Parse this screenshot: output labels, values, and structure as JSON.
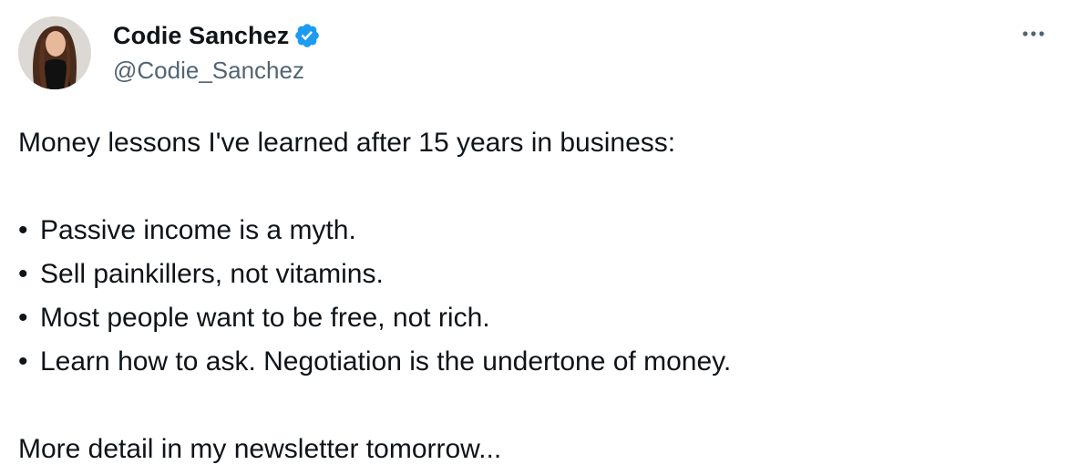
{
  "author": {
    "display_name": "Codie Sanchez",
    "handle": "@Codie_Sanchez",
    "verified": true
  },
  "tweet": {
    "intro": "Money lessons I've learned after 15 years in business:",
    "bullet_char": "•",
    "bullets": [
      "Passive income is a myth.",
      "Sell painkillers, not vitamins.",
      "Most people want to be free, not rich.",
      "Learn how to ask. Negotiation is the undertone of money."
    ],
    "closing": "More detail in my newsletter tomorrow..."
  },
  "menu": {
    "more_label": "..."
  },
  "icons": {
    "verified": "verified-badge-icon",
    "more": "more-options-icon"
  },
  "colors": {
    "verified_blue": "#1d9bf0",
    "secondary_text": "#536471",
    "primary_text": "#0f1419"
  }
}
